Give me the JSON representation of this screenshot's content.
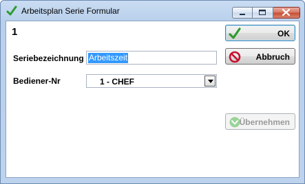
{
  "window": {
    "title": "Arbeitsplan Serie Formular",
    "record_number": "1"
  },
  "form": {
    "series_label": "Seriebezeichnung",
    "series_value": "Arbeitszeit",
    "operator_label": "Bediener-Nr",
    "operator_value": "1 - CHEF"
  },
  "buttons": {
    "ok": "OK",
    "cancel": "Abbruch",
    "apply": "Übernehmen"
  },
  "colors": {
    "selection": "#3399ff",
    "ok_check": "#2e9b2e",
    "cancel_icon": "#c8102e",
    "apply_icon": "#9ad39a"
  }
}
